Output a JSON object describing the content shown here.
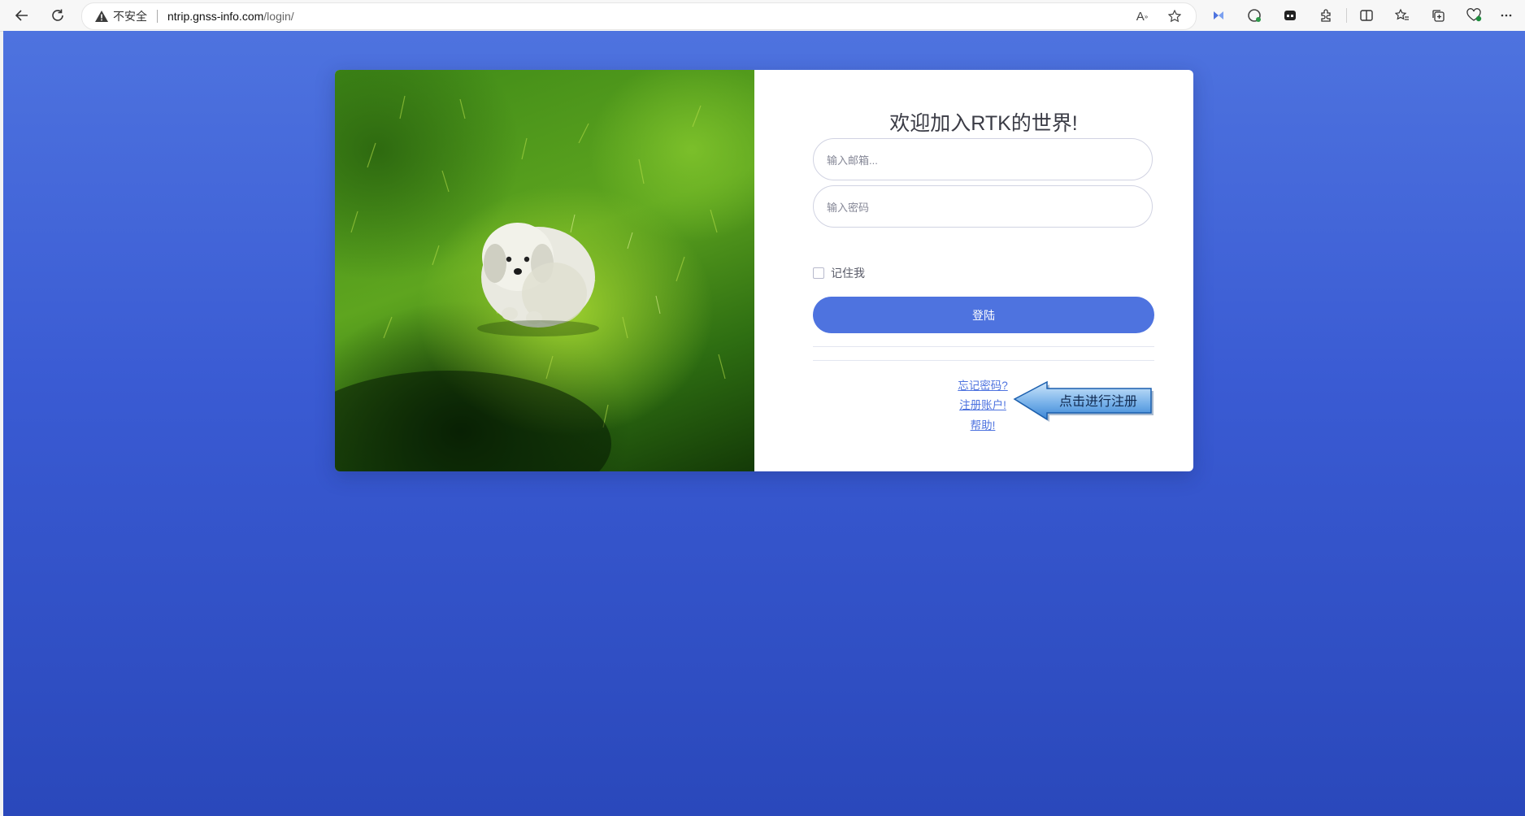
{
  "browser": {
    "security_label": "不安全",
    "url_host": "ntrip.gnss-info.com",
    "url_path": "/login/",
    "icons": [
      "back-icon",
      "reload-icon",
      "warning-icon",
      "read-aloud-icon",
      "favorite-star-icon",
      "copilot-icon",
      "grammarly-icon",
      "extension-icon",
      "extensions-puzzle-icon",
      "split-screen-icon",
      "favorites-icon",
      "collections-icon",
      "health-icon",
      "more-icon"
    ]
  },
  "login": {
    "title": "欢迎加入RTK的世界!",
    "email_placeholder": "输入邮箱...",
    "password_placeholder": "输入密码",
    "remember_label": "记住我",
    "login_button": "登陆",
    "forgot_link": "忘记密码?",
    "register_link": "注册账户!",
    "help_link": "帮助!"
  },
  "annotation": {
    "callout_text": "点击进行注册"
  },
  "colors": {
    "primary": "#4e73df",
    "background_top": "#4e73df",
    "background_bottom": "#2a48bb"
  }
}
